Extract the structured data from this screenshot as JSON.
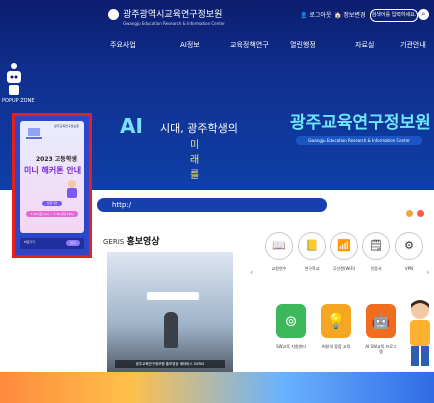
{
  "header": {
    "logo_title": "광주광역시교육연구정보원",
    "logo_sub": "Gwangju Education Research & Information Center",
    "util_login": "로그아웃",
    "util_sitemap": "정보변경",
    "search_placeholder": "검색어를 입력하세요.",
    "search_icon": "search-icon"
  },
  "gnb": [
    "주요사업",
    "AI정보",
    "교육정책연구",
    "열린행정",
    "자료실",
    "기관안내"
  ],
  "side": {
    "popup_label": "POPUP ZONE"
  },
  "hero": {
    "ai": "AI",
    "text1": "시대, 광주학생의",
    "text2": "미래를",
    "title": "광주교육연구정보원",
    "subtitle": "Gwangju Education Research & Information Center"
  },
  "urlbar": {
    "text": "http:/"
  },
  "promo": {
    "title_prefix": "GERIS",
    "title": "홍보영상",
    "video_caption": "광주교육연구정보원 홍보영상 메타버스 GERIS"
  },
  "quick_links": [
    {
      "label": "교원연수",
      "icon": "📖"
    },
    {
      "label": "연구학교",
      "icon": "📒"
    },
    {
      "label": "무선랜(WiFi)",
      "icon": "📶"
    },
    {
      "label": "인증서",
      "icon": "🗒"
    },
    {
      "label": "VPN",
      "icon": "⚙"
    }
  ],
  "sw_links": [
    {
      "label": "SW교육 지원센터",
      "icon": "⊚",
      "color": "#3cb85a"
    },
    {
      "label": "AI창의 융합 교육",
      "icon": "💡",
      "color": "#f5a623"
    },
    {
      "label": "AI·SW교육 프로그램",
      "icon": "🤖",
      "color": "#f06d1e"
    }
  ],
  "popup": {
    "org": "광주교육연구정보원",
    "year_line": "2023 고등학생",
    "title": "미니 해커톤 안내",
    "button": "신청기간",
    "date": "7.15.(토) 9시 ~ 7.18.(화) 16시",
    "more": "바로가기",
    "close": "닫기"
  },
  "colors": {
    "navy": "#0c1d6e",
    "accent": "#6fe6ff",
    "popup_border": "#e3211c"
  }
}
